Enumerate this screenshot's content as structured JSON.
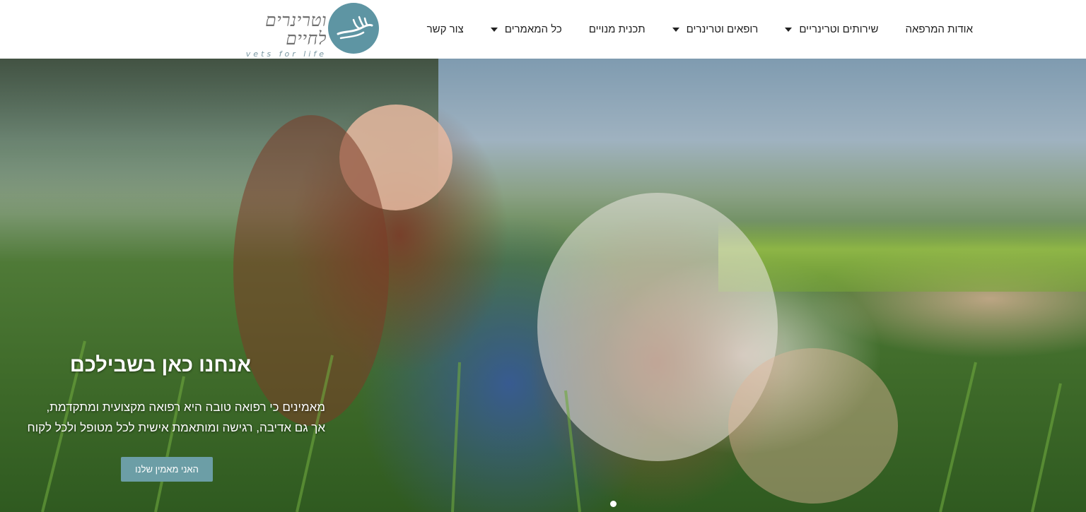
{
  "header": {
    "logo": {
      "hebrew": "וטרינרים לחיים",
      "english": "vets for life"
    },
    "nav": [
      {
        "label": "אודות המרפאה",
        "has_dropdown": false
      },
      {
        "label": "שירותים וטרינריים",
        "has_dropdown": true
      },
      {
        "label": "רופאים וטרינרים",
        "has_dropdown": true
      },
      {
        "label": "תכנית מנויים",
        "has_dropdown": false
      },
      {
        "label": "כל המאמרים",
        "has_dropdown": true
      },
      {
        "label": "צור קשר",
        "has_dropdown": false
      }
    ]
  },
  "hero": {
    "title": "אנחנו כאן בשבילכם",
    "text_line1": "מאמינים כי רפואה טובה היא רפואה מקצועית ומתקדמת,",
    "text_line2": "אך גם אדיבה, רגישה ומותאמת אישית לכל מטופל ולכל לקוח",
    "button_label": "האני מאמין שלנו"
  },
  "colors": {
    "accent": "#5e95a3",
    "button": "#6c9ea6"
  }
}
